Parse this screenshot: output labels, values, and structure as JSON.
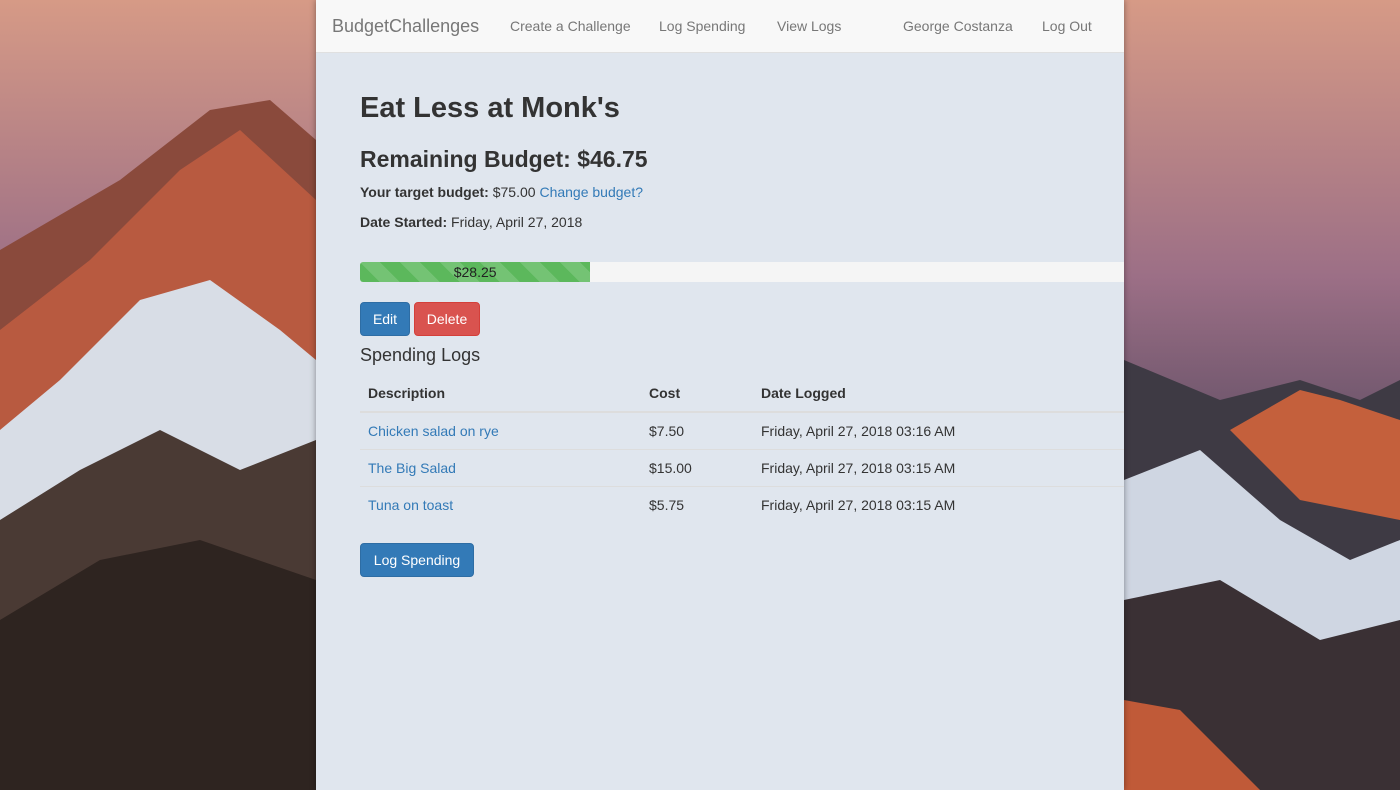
{
  "nav": {
    "brand": "BudgetChallenges",
    "links": [
      "Create a Challenge",
      "Log Spending",
      "View Logs"
    ],
    "user": "George Costanza",
    "logout": "Log Out"
  },
  "challenge": {
    "title": "Eat Less at Monk's",
    "remaining_label": "Remaining Budget: $46.75",
    "target_label": "Your target budget:",
    "target_value": "$75.00",
    "change_link": "Change budget?",
    "date_label": "Date Started:",
    "date_value": "Friday, April 27, 2018",
    "progress_text": "$28.25",
    "progress_fraction": 0.3767
  },
  "buttons": {
    "edit": "Edit",
    "delete": "Delete",
    "log_spending": "Log Spending"
  },
  "logs": {
    "heading": "Spending Logs",
    "columns": [
      "Description",
      "Cost",
      "Date Logged"
    ],
    "rows": [
      {
        "description": "Chicken salad on rye",
        "cost": "$7.50",
        "date": "Friday, April 27, 2018 03:16 AM"
      },
      {
        "description": "The Big Salad",
        "cost": "$15.00",
        "date": "Friday, April 27, 2018 03:15 AM"
      },
      {
        "description": "Tuna on toast",
        "cost": "$5.75",
        "date": "Friday, April 27, 2018 03:15 AM"
      }
    ]
  },
  "colors": {
    "primary": "#337ab7",
    "danger": "#d9534f",
    "success": "#5cb85c",
    "page_bg": "#e0e6ee"
  }
}
